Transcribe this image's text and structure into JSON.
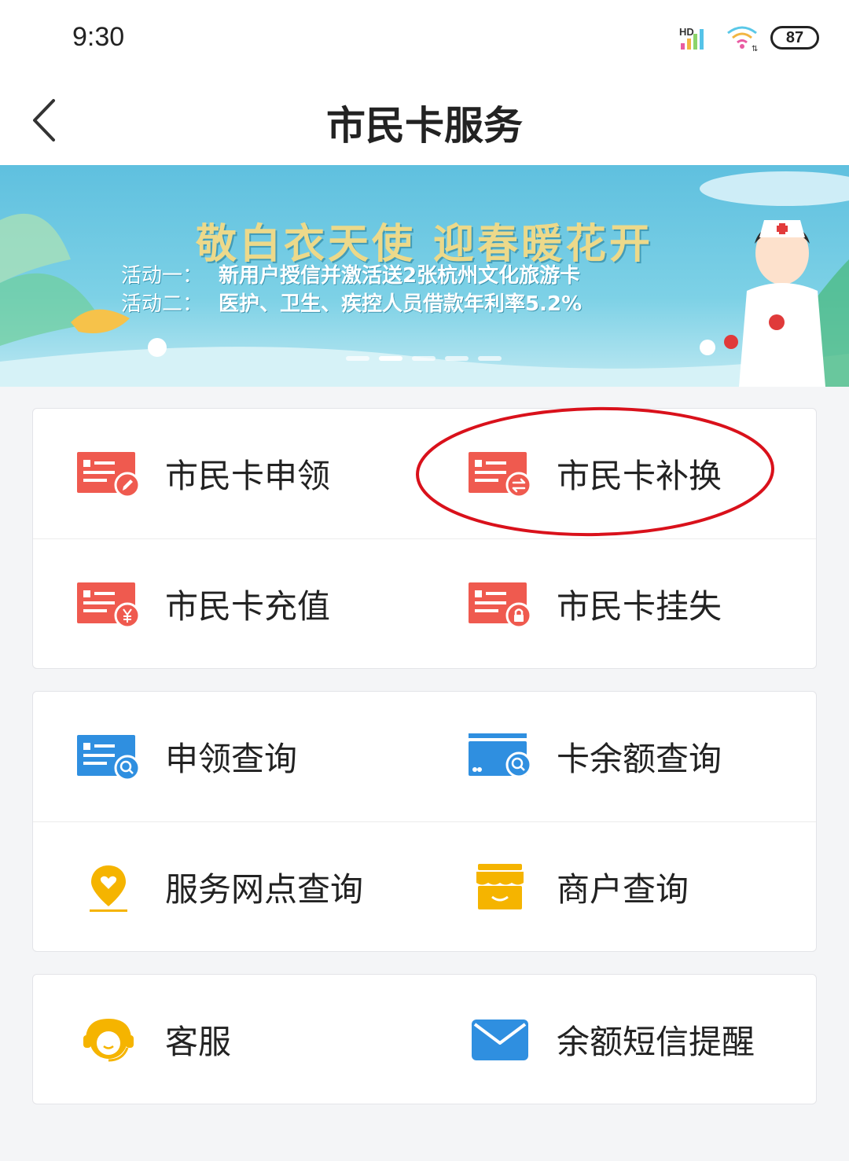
{
  "status_bar": {
    "time": "9:30",
    "signal_label": "HD",
    "battery": "87"
  },
  "header": {
    "title": "市民卡服务",
    "back_icon": "back-chevron-icon"
  },
  "banner": {
    "title": "敬白衣天使 迎春暖花开",
    "lines": [
      {
        "label": "活动一：",
        "text": "新用户授信并激活送2张杭州文化旅游卡"
      },
      {
        "label": "活动二：",
        "text": "医护、卫生、疾控人员借款年利率5.2%"
      }
    ]
  },
  "groups": [
    {
      "items": [
        {
          "label": "市民卡申领",
          "icon": "card-apply-icon",
          "color": "#ef5a4f"
        },
        {
          "label": "市民卡补换",
          "icon": "card-replace-icon",
          "color": "#ef5a4f"
        },
        {
          "label": "市民卡充值",
          "icon": "card-recharge-icon",
          "color": "#ef5a4f"
        },
        {
          "label": "市民卡挂失",
          "icon": "card-lock-icon",
          "color": "#ef5a4f"
        }
      ]
    },
    {
      "items": [
        {
          "label": "申领查询",
          "icon": "apply-search-icon",
          "color": "#2f8fe0"
        },
        {
          "label": "卡余额查询",
          "icon": "balance-search-icon",
          "color": "#2f8fe0"
        },
        {
          "label": "服务网点查询",
          "icon": "location-pin-icon",
          "color": "#f5b400"
        },
        {
          "label": "商户查询",
          "icon": "store-icon",
          "color": "#f5b400"
        }
      ]
    },
    {
      "items": [
        {
          "label": "客服",
          "icon": "customer-service-icon",
          "color": "#f5b400"
        },
        {
          "label": "余额短信提醒",
          "icon": "envelope-icon",
          "color": "#2f8fe0"
        }
      ]
    }
  ],
  "annotation": {
    "highlight_color": "#d9111b"
  }
}
